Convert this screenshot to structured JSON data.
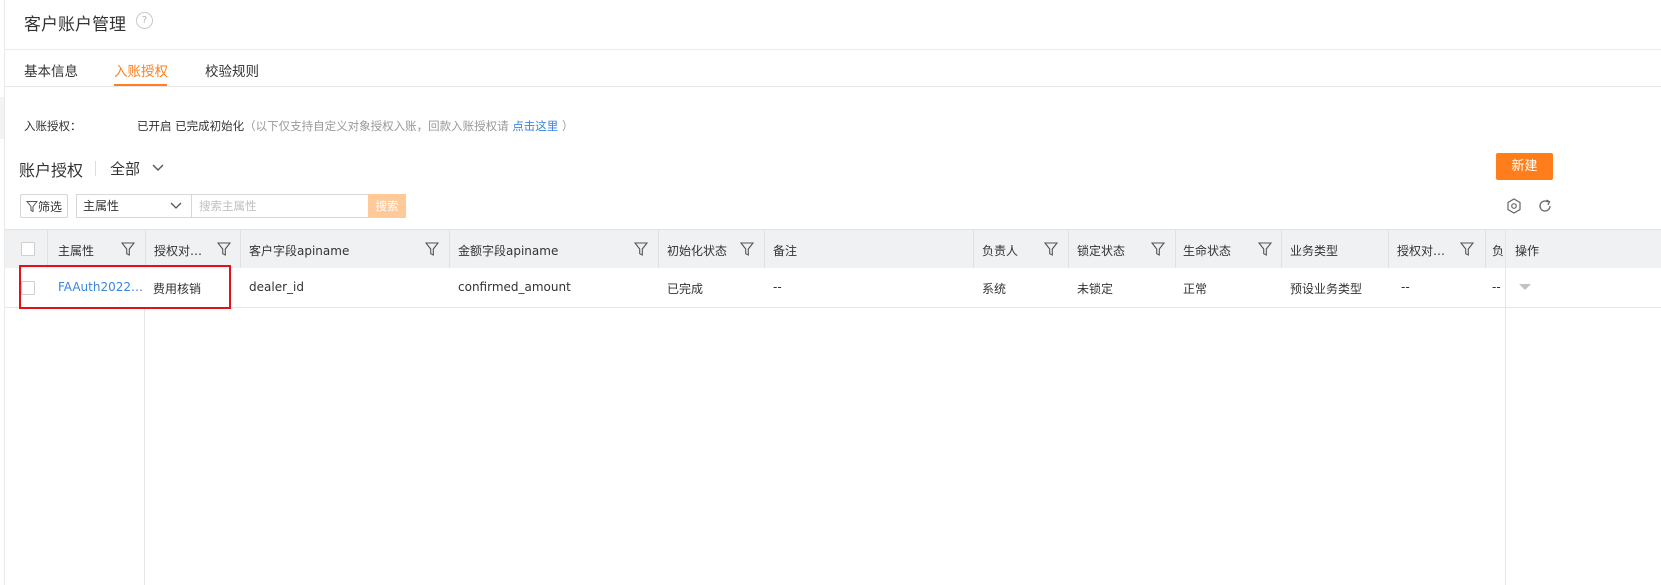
{
  "header": {
    "title": "客户账户管理",
    "help": "?"
  },
  "tabs": [
    {
      "label": "基本信息",
      "active": false
    },
    {
      "label": "入账授权",
      "active": true
    },
    {
      "label": "校验规则",
      "active": false
    }
  ],
  "auth": {
    "label": "入账授权：",
    "status": "已开启  已完成初始化",
    "tip_prefix": "（以下仅支持自定义对象授权入账，回款入账授权请 ",
    "tip_link": "点击这里",
    "tip_suffix": " ）"
  },
  "section": {
    "title": "账户授权",
    "view": "全部"
  },
  "toolbar": {
    "filter_label": "筛选",
    "attr_select": "主属性",
    "search_placeholder": "搜索主属性",
    "search_label": "搜索",
    "new_label": "新建"
  },
  "columns": [
    "主属性",
    "授权对…",
    "客户字段apiname",
    "金额字段apiname",
    "初始化状态",
    "备注",
    "负责人",
    "锁定状态",
    "生命状态",
    "业务类型",
    "授权对…",
    "负",
    "操作"
  ],
  "rows": [
    {
      "primary": "FAAuth2022…",
      "auth_obj": "费用核销",
      "customer_field": "dealer_id",
      "amount_field": "confirmed_amount",
      "init_status": "已完成",
      "remark": "--",
      "owner": "系统",
      "lock_status": "未锁定",
      "life_status": "正常",
      "biz_type": "预设业务类型",
      "auth_obj2": "--",
      "extra": "--"
    }
  ],
  "colors": {
    "accent": "#ff7e1b",
    "link": "#3a84e0",
    "highlight": "#e2121b"
  }
}
